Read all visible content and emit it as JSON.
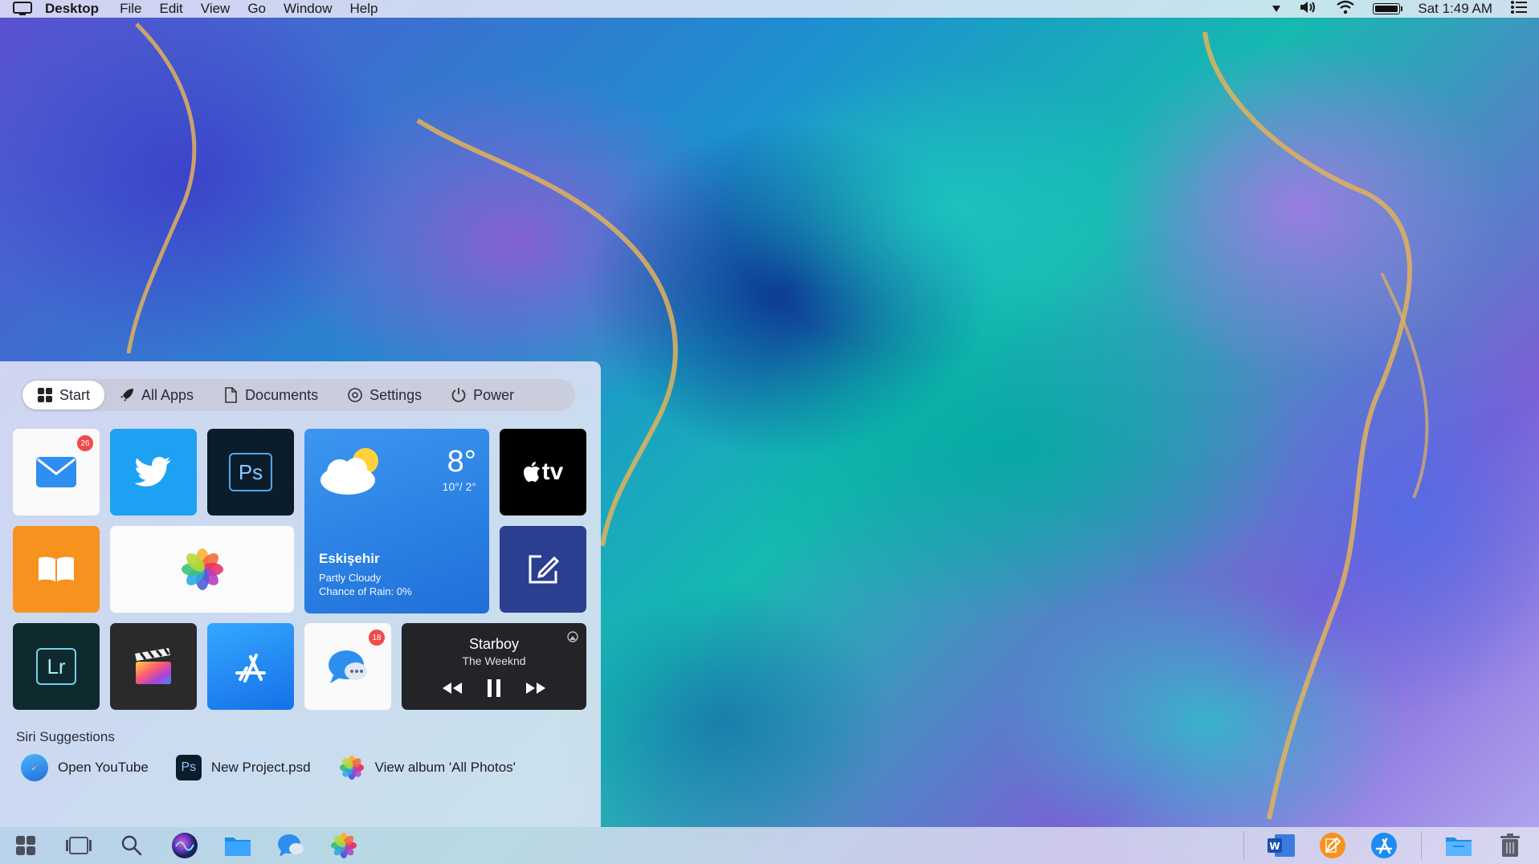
{
  "menubar": {
    "app_name": "Desktop",
    "menus": [
      "File",
      "Edit",
      "View",
      "Go",
      "Window",
      "Help"
    ],
    "clock": "Sat 1:49 AM",
    "icons": [
      "finder-icon",
      "dropdown-icon",
      "volume-icon",
      "wifi-icon",
      "battery-icon",
      "menu-list-icon"
    ]
  },
  "start": {
    "tabs": [
      {
        "label": "Start",
        "icon": "windows-grid-icon"
      },
      {
        "label": "All Apps",
        "icon": "rocket-icon"
      },
      {
        "label": "Documents",
        "icon": "document-icon"
      },
      {
        "label": "Settings",
        "icon": "gear-icon"
      },
      {
        "label": "Power",
        "icon": "power-icon"
      }
    ],
    "tiles": {
      "mail": {
        "name": "Mail",
        "badge": "26"
      },
      "twitter": {
        "name": "Twitter"
      },
      "photoshop": {
        "name": "Photoshop",
        "glyph": "Ps"
      },
      "appletv": {
        "name": "Apple TV",
        "glyph": "tv"
      },
      "books": {
        "name": "Books"
      },
      "photos": {
        "name": "Photos"
      },
      "notes": {
        "name": "Compose"
      },
      "lightroom": {
        "name": "Lightroom",
        "glyph": "Lr"
      },
      "final_cut": {
        "name": "Final Cut Pro"
      },
      "app_store": {
        "name": "App Store"
      },
      "messages": {
        "name": "Messages",
        "badge": "18"
      }
    },
    "weather": {
      "temp": "8°",
      "range": "10°/ 2°",
      "city": "Eskişehir",
      "condition": "Partly Cloudy",
      "rain": "Chance of Rain: 0%"
    },
    "music": {
      "title": "Starboy",
      "artist": "The Weeknd"
    },
    "siri": {
      "title": "Siri Suggestions",
      "items": [
        {
          "label": "Open YouTube",
          "icon": "safari-icon"
        },
        {
          "label": "New Project.psd",
          "icon": "photoshop-icon"
        },
        {
          "label": "View album 'All Photos'",
          "icon": "photos-icon"
        }
      ]
    }
  },
  "taskbar": {
    "left": [
      "start-icon",
      "task-view-icon",
      "search-icon",
      "siri-icon",
      "files-icon",
      "messages-icon",
      "photos-icon"
    ],
    "right": [
      "word-icon",
      "pages-icon",
      "app-store-icon",
      "folder-icon",
      "trash-icon"
    ]
  },
  "colors": {
    "accent_blue": "#1f6fd8",
    "twitter_blue": "#1da1f2",
    "books_orange": "#f7921e",
    "notes_navy": "#2b3e8f",
    "badge_red": "#f04a4a"
  }
}
